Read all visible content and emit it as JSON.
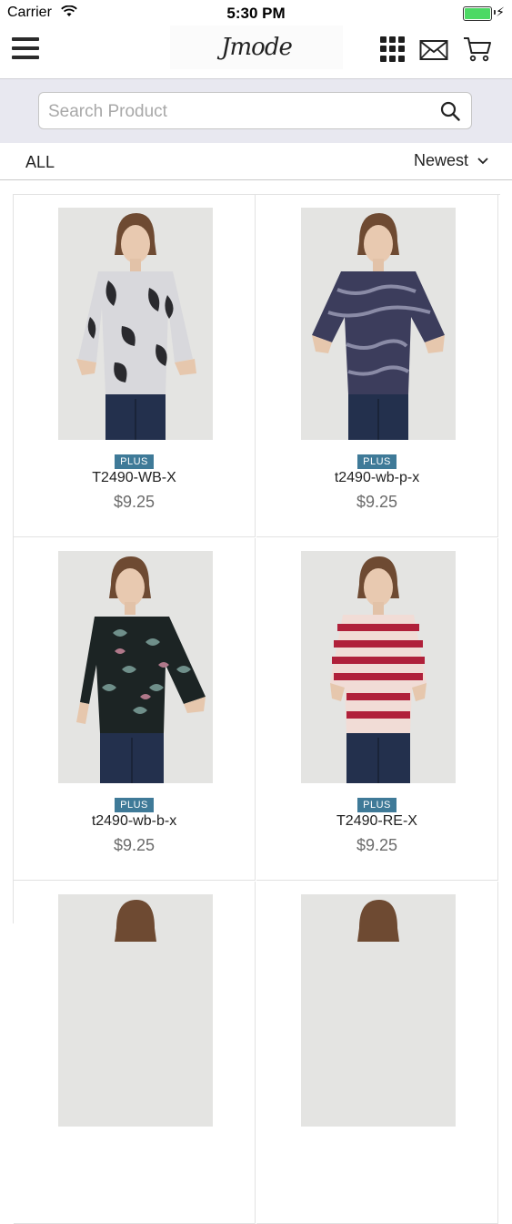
{
  "status_bar": {
    "carrier": "Carrier",
    "time": "5:30 PM",
    "battery_level": 1.0,
    "battery_color": "#4cd964"
  },
  "nav": {
    "logo_text": "Jmode",
    "icons": [
      "menu-icon",
      "grid-icon",
      "mail-icon",
      "cart-icon"
    ]
  },
  "search": {
    "placeholder": "Search Product",
    "value": "",
    "icon": "search-icon"
  },
  "filter": {
    "category": "ALL",
    "sort": "Newest",
    "sort_icon": "chevron-down-icon"
  },
  "products": [
    {
      "badge": "PLUS",
      "name": "T2490-WB-X",
      "price": "$9.25",
      "pattern": "white-black-floral",
      "colors": [
        "#d8d8dc",
        "#2a2a2e"
      ]
    },
    {
      "badge": "PLUS",
      "name": "t2490-wb-p-x",
      "price": "$9.25",
      "pattern": "navy-paisley",
      "colors": [
        "#3c3d5c",
        "#8a8ba6"
      ]
    },
    {
      "badge": "PLUS",
      "name": "t2490-wb-b-x",
      "price": "$9.25",
      "pattern": "black-floral",
      "colors": [
        "#1c2424",
        "#6f8f8a"
      ]
    },
    {
      "badge": "PLUS",
      "name": "T2490-RE-X",
      "price": "$9.25",
      "pattern": "red-stripe",
      "colors": [
        "#f1dcd6",
        "#b0203a"
      ]
    },
    {
      "badge": "",
      "name": "",
      "price": "",
      "pattern": "partial",
      "colors": [
        "#d8d8d8",
        "#999999"
      ]
    },
    {
      "badge": "",
      "name": "",
      "price": "",
      "pattern": "partial",
      "colors": [
        "#d8d8d8",
        "#999999"
      ]
    }
  ],
  "colors": {
    "accent_badge": "#3f7a98",
    "search_band": "#e8e8f0"
  }
}
